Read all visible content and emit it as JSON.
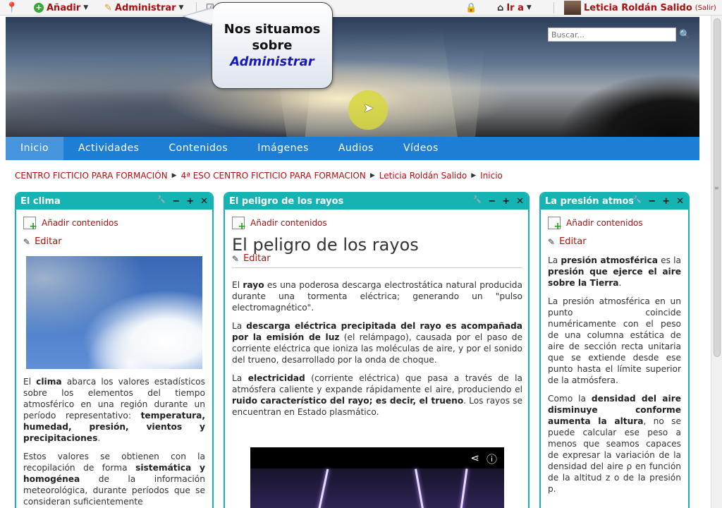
{
  "topbar": {
    "add_label": "Añadir",
    "admin_label": "Administrar",
    "goto_label": "Ir a",
    "user_name": "Leticia Roldán Salido",
    "logout_label": "(Salir)"
  },
  "tooltip": {
    "line1": "Nos situamos",
    "line2": "sobre",
    "line3": "Administrar"
  },
  "search": {
    "placeholder": "Buscar..."
  },
  "nav": {
    "items": [
      "Inicio",
      "Actividades",
      "Contenidos",
      "Imágenes",
      "Audios",
      "Vídeos"
    ]
  },
  "breadcrumb": {
    "items": [
      "CENTRO FICTICIO PARA FORMACIÓN",
      "4ª ESO CENTRO FICTICIO PARA FORMACION",
      "Leticia Roldán Salido",
      "Inicio"
    ]
  },
  "blocks": {
    "clima": {
      "title": "El clima",
      "add_label": "Añadir contenidos",
      "edit_label": "Editar",
      "p1_a": "El ",
      "p1_b": "clima",
      "p1_c": " abarca los valores estadísticos sobre los elementos del tiempo atmosférico en una región durante un período representativo: ",
      "p1_d": "temperatura, humedad, presión, vientos y precipitaciones",
      "p1_e": ".",
      "p2_a": "Estos valores se obtienen con la recopilación de forma ",
      "p2_b": "sistemática y homogénea",
      "p2_c": " de la información meteorológica, durante períodos que se consideran suficientemente"
    },
    "rayos": {
      "title": "El peligro de los rayos",
      "add_label": "Añadir contenidos",
      "heading": "El peligro de los rayos",
      "edit_label": "Editar",
      "p1_a": "El ",
      "p1_b": "rayo",
      "p1_c": " es una poderosa descarga electrostática natural producida durante una tormenta eléctrica; generando un \"pulso electromagnético\".",
      "p2_a": "La ",
      "p2_b": "descarga eléctrica precipitada del rayo es acompañada por la emisión de luz",
      "p2_c": " (el relámpago), causada por el paso de corriente eléctrica que ioniza las moléculas de aire, y por el sonido del trueno, desarrollado por la onda de choque.",
      "p3_a": "La ",
      "p3_b": "electricidad",
      "p3_c": " (corriente eléctrica) que pasa a través de la atmósfera caliente y expande rápidamente el aire, produciendo el ",
      "p3_d": "ruido característico del rayo; es decir, el trueno",
      "p3_e": ". Los rayos se encuentran en Estado plasmático."
    },
    "presion": {
      "title": "La presión atmosférica",
      "add_label": "Añadir contenidos",
      "edit_label": "Editar",
      "p1_a": "La ",
      "p1_b": "presión atmosférica",
      "p1_c": " es la ",
      "p1_d": "presión que ejerce el aire sobre la Tierra",
      "p1_e": ".",
      "p2": "La presión atmosférica en un punto coincide numéricamente con el peso de una columna estática de aire de sección recta unitaria que se extiende desde ese punto hasta el límite superior de la atmósfera.",
      "p3_a": "Como la ",
      "p3_b": "densidad del aire disminuye conforme aumenta la altura",
      "p3_c": ", no se puede calcular ese peso a menos que seamos capaces de expresar la variación de la densidad del aire ρ en función de la altitud z o de la presión p."
    }
  },
  "block_tools": {
    "wrench": "🔧",
    "minus": "−",
    "plus": "+",
    "close": "✕"
  },
  "colors": {
    "accent": "#16b3b3",
    "nav": "#1e7ed4",
    "link": "#b01010"
  }
}
